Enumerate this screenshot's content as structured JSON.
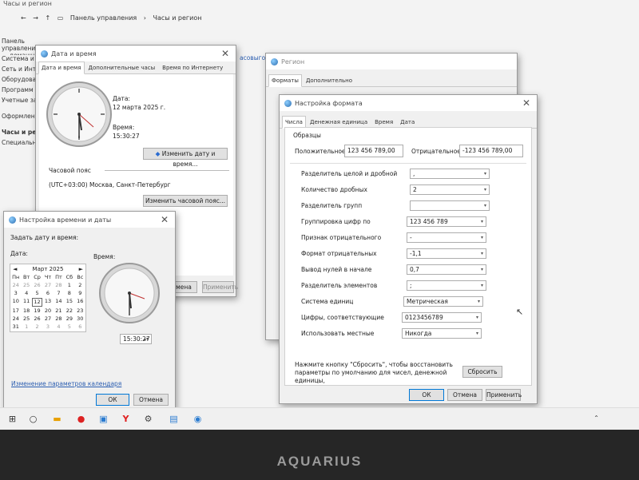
{
  "control_panel": {
    "window_title": "Часы и регион",
    "breadcrumb": [
      "Панель управления",
      "Часы и регион"
    ],
    "sidebar": [
      "Панель управления — домашняя",
      "Система и",
      "Сеть и Инте",
      "Оборудова",
      "Программ",
      "Учетные за",
      "Оформлен",
      "Часы и реги",
      "Специальн"
    ],
    "link_fragment": "асовыго"
  },
  "date_time_window": {
    "title": "Дата и время",
    "tabs": [
      "Дата и время",
      "Дополнительные часы",
      "Время по Интернету"
    ],
    "date_label": "Дата:",
    "date_value": "12 марта 2025 г.",
    "time_label": "Время:",
    "time_value": "15:30:27",
    "change_datetime_btn": "Изменить дату и время...",
    "timezone_label": "Часовой пояс",
    "timezone_value": "(UTC+03:00) Москва, Санкт-Петербург",
    "change_timezone_btn": "Изменить часовой пояс...",
    "ok_btn_fragment": "мена",
    "apply_btn": "Применить"
  },
  "set_time_window": {
    "title": "Настройка времени и даты",
    "subtitle": "Задать дату и время:",
    "date_label": "Дата:",
    "time_label": "Время:",
    "calendar": {
      "month": "Март 2025",
      "prev": "◄",
      "next": "►",
      "weekdays": [
        "Пн",
        "Вт",
        "Ср",
        "Чт",
        "Пт",
        "Сб",
        "Вс"
      ],
      "days": [
        "24",
        "25",
        "26",
        "27",
        "28",
        "1",
        "2",
        "3",
        "4",
        "5",
        "6",
        "7",
        "8",
        "9",
        "10",
        "11",
        "12",
        "13",
        "14",
        "15",
        "16",
        "17",
        "18",
        "19",
        "20",
        "21",
        "22",
        "23",
        "24",
        "25",
        "26",
        "27",
        "28",
        "29",
        "30",
        "31",
        "1",
        "2",
        "3",
        "4",
        "5",
        "6"
      ],
      "selected": "12"
    },
    "time_value": "15:30:27",
    "change_calendar_link": "Изменение параметров календаря",
    "ok_btn": "ОК",
    "cancel_btn": "Отмена"
  },
  "region_window": {
    "title": "Регион",
    "tabs": [
      "Форматы",
      "Дополнительно"
    ]
  },
  "format_window": {
    "title": "Настройка формата",
    "tabs": [
      "Числа",
      "Денежная единица",
      "Время",
      "Дата"
    ],
    "samples_label": "Образцы",
    "positive_label": "Положительное:",
    "positive_value": "123 456 789,00",
    "negative_label": "Отрицательное:",
    "negative_value": "-123 456 789,00",
    "rows": [
      {
        "label": "Разделитель целой и дробной",
        "value": ","
      },
      {
        "label": "Количество дробных",
        "value": "2"
      },
      {
        "label": "Разделитель групп",
        "value": ""
      },
      {
        "label": "Группировка цифр по",
        "value": "123 456 789"
      },
      {
        "label": "Признак отрицательного",
        "value": "-"
      },
      {
        "label": "Формат отрицательных",
        "value": "-1,1"
      },
      {
        "label": "Вывод нулей в начале",
        "value": "0,7"
      },
      {
        "label": "Разделитель элементов",
        "value": ";"
      },
      {
        "label": "Система единиц",
        "value": "Метрическая"
      },
      {
        "label": "Цифры, соответствующие",
        "value": "0123456789"
      },
      {
        "label": "Использовать местные",
        "value": "Никогда"
      }
    ],
    "reset_text": "Нажмите кнопку \"Сбросить\", чтобы восстановить параметры по умолчанию для чисел, денежной единицы,",
    "reset_btn": "Сбросить",
    "ok_btn": "ОК",
    "cancel_btn": "Отмена",
    "apply_btn": "Применить"
  },
  "laptop_brand": "AQUARIUS"
}
